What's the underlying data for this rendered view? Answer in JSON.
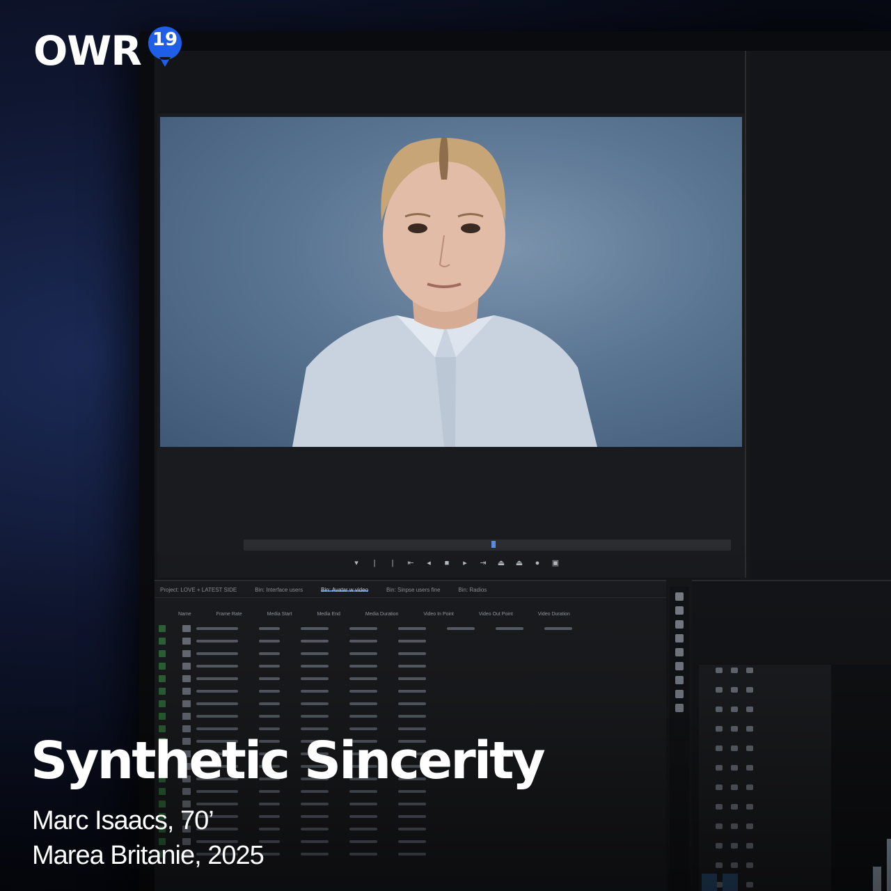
{
  "logo": {
    "text": "OWR",
    "badge": "19",
    "badge_color": "#1f5fe8"
  },
  "film": {
    "title": "Synthetic Sincerity",
    "director_line": "Marc Isaacs, 70’",
    "country_year_line": "Marea Britanie, 2025"
  },
  "editor": {
    "accent": "#5d8be0",
    "project_tabs": [
      "Project: LOVE + LATEST SIDE",
      "Bin: Interface users",
      "Bin: Avatar w video",
      "Bin: Sinpse users fine",
      "Bin: Radios"
    ],
    "column_headers": [
      "Name",
      "Frame Rate",
      "Media Start",
      "Media End",
      "Media Duration",
      "Video In Point",
      "Video Out Point",
      "Video Duration"
    ]
  }
}
